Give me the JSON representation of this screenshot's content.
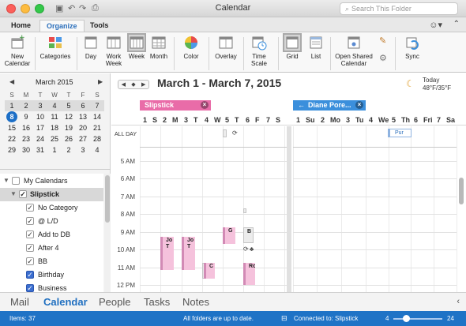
{
  "window": {
    "title": "Calendar",
    "search_placeholder": "Search This Folder"
  },
  "tabs": [
    {
      "label": "Home"
    },
    {
      "label": "Organize",
      "active": true
    },
    {
      "label": "Tools"
    }
  ],
  "ribbon": {
    "new_calendar": "New\nCalendar",
    "categories": "Categories",
    "day": "Day",
    "work_week": "Work\nWeek",
    "week": "Week",
    "month": "Month",
    "color": "Color",
    "overlay": "Overlay",
    "time_scale": "Time\nScale",
    "grid": "Grid",
    "list": "List",
    "open_shared": "Open Shared\nCalendar",
    "sync": "Sync"
  },
  "mini_calendar": {
    "month": "March 2015",
    "weekday_headers": [
      "S",
      "M",
      "T",
      "W",
      "T",
      "F",
      "S"
    ],
    "weeks": [
      [
        "1",
        "2",
        "3",
        "4",
        "5",
        "6",
        "7"
      ],
      [
        "8",
        "9",
        "10",
        "11",
        "12",
        "13",
        "14"
      ],
      [
        "15",
        "16",
        "17",
        "18",
        "19",
        "20",
        "21"
      ],
      [
        "22",
        "23",
        "24",
        "25",
        "26",
        "27",
        "28"
      ],
      [
        "29",
        "30",
        "31",
        "1",
        "2",
        "3",
        "4"
      ]
    ],
    "today": "8"
  },
  "calendar_list": {
    "group": "My Calendars",
    "calendar": "Slipstick",
    "categories": [
      "No Category",
      "@ L/D",
      "Add to DB",
      "After 4",
      "BB",
      "Birthday",
      "Business"
    ]
  },
  "header": {
    "date_range": "March 1 - March 7, 2015",
    "weather_day": "Today",
    "weather_temp": "48°F/35°F"
  },
  "calendars": [
    {
      "name": "Slipstick",
      "color": "#e96ca8",
      "day_headers": [
        "1",
        "S",
        "2",
        "M",
        "3",
        "T",
        "4",
        "W",
        "5",
        "T",
        "6",
        "F",
        "7",
        "S"
      ]
    },
    {
      "name": "Diane Pore...",
      "color": "#3b8fdc",
      "day_headers": [
        "1",
        "Su",
        "2",
        "Mo",
        "3",
        "Tu",
        "4",
        "We",
        "5",
        "Th",
        "6",
        "Fri",
        "7",
        "Sa"
      ]
    }
  ],
  "all_day_label": "ALL DAY",
  "hours": [
    "5 AM",
    "6 AM",
    "7 AM",
    "8 AM",
    "9 AM",
    "10 AM",
    "11 AM",
    "12 PM"
  ],
  "events": {
    "jot1": "Jo\nT",
    "jot2": "Jo\nT",
    "c": "C",
    "g": "G",
    "b": "B",
    "ro": "Ro",
    "pur": "Pur"
  },
  "bottom_nav": [
    "Mail",
    "Calendar",
    "People",
    "Tasks",
    "Notes"
  ],
  "status": {
    "items": "Items: 37",
    "sync": "All folders are up to date.",
    "connection": "Connected to: Slipstick",
    "zoom_min": "4",
    "zoom_max": "24"
  },
  "colors": {
    "accent": "#1f73c6",
    "slipstick": "#e96ca8",
    "diane": "#3b8fdc",
    "event_pink": "#f5c2dc"
  }
}
